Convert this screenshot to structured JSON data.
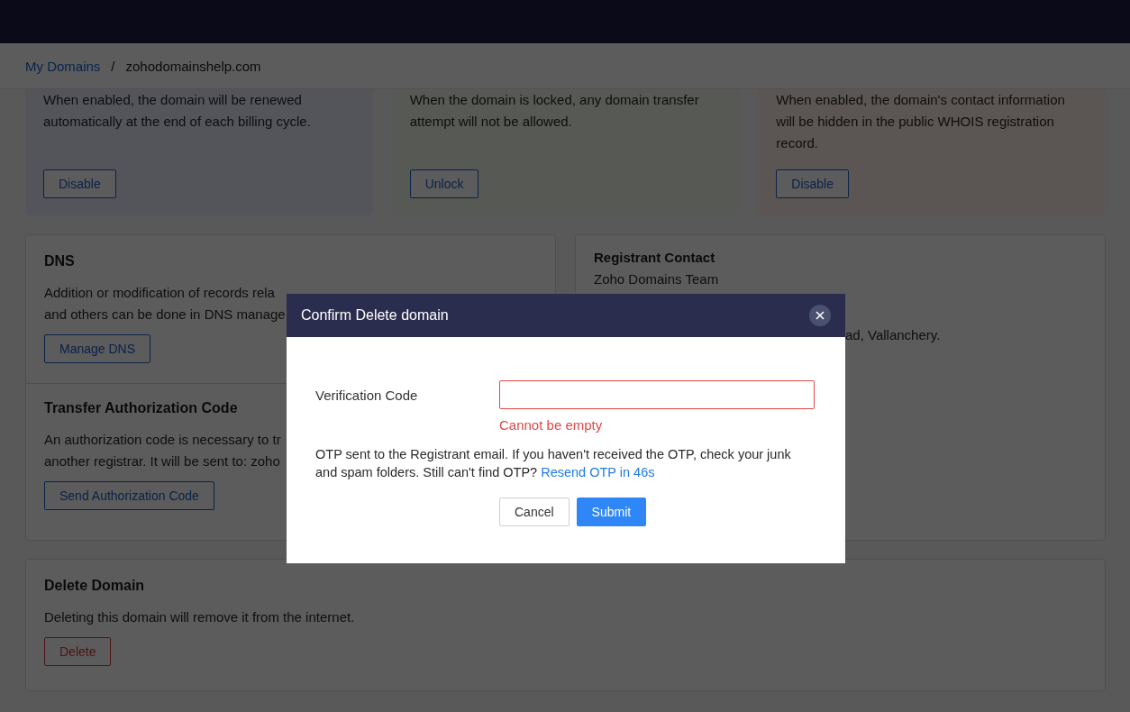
{
  "breadcrumb": {
    "items": [
      {
        "label": "My Domains",
        "kind": "link"
      },
      {
        "label": "zohodomainshelp.com",
        "kind": "current"
      }
    ],
    "separator": "/"
  },
  "feature_cards": [
    {
      "text": "When enabled, the domain will be renewed automatically at the end of each billing cycle.",
      "button": "Disable"
    },
    {
      "text": "When the domain is locked, any domain transfer attempt will not be allowed.",
      "button": "Unlock"
    },
    {
      "text": "When enabled, the domain's contact information will be hidden in the public WHOIS registration record.",
      "button": "Disable"
    }
  ],
  "dns_card": {
    "sections": [
      {
        "title": "DNS",
        "lines": [
          "Addition or modification of records rela",
          "and others can be done in DNS manage"
        ],
        "button": "Manage DNS"
      },
      {
        "title": "Transfer Authorization Code",
        "lines": [
          "An authorization code is necessary to tr",
          "another registrar. It will be sent to: zoho"
        ],
        "button": "Send Authorization Code"
      }
    ]
  },
  "registrant_contact": {
    "title": "Registrant Contact",
    "lines": [
      {
        "text": "Zoho Domains Team",
        "kind": "full"
      },
      {
        "text": "ad, Vallanchery.",
        "kind": "partial"
      }
    ]
  },
  "delete_card": {
    "title": "Delete Domain",
    "text": "Deleting this domain will remove it from the internet.",
    "button": "Delete"
  },
  "dialog": {
    "title": "Confirm Delete domain",
    "field_label": "Verification Code",
    "error": "Cannot be empty",
    "message": "OTP sent to the Registrant email. If you haven't received the OTP, check your junk and spam folders. Still can't find OTP?",
    "link": "Resend OTP in 46s",
    "buttons": [
      {
        "label": "Cancel",
        "kind": "secondary"
      },
      {
        "label": "Submit",
        "kind": "primary"
      }
    ]
  }
}
